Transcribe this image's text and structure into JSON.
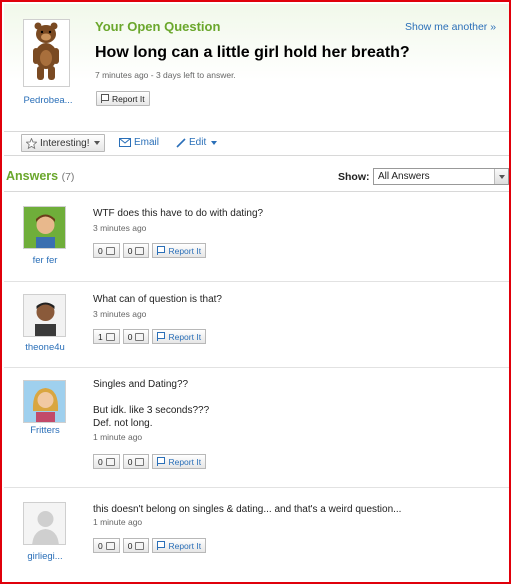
{
  "question": {
    "header_label": "Your Open Question",
    "show_another": "Show me another »",
    "title": "How long can a little girl hold her breath?",
    "meta": "7 minutes ago - 3 days left to answer.",
    "asker": "Pedrobea...",
    "report_label": "Report It"
  },
  "actions": {
    "interesting": "Interesting!",
    "email": "Email",
    "edit": "Edit"
  },
  "answers_header": {
    "title": "Answers",
    "count": "(7)",
    "show_label": "Show:",
    "show_value": "All Answers"
  },
  "answers": [
    {
      "user": "fer fer",
      "lines": [
        "WTF does this have to do with dating?"
      ],
      "time": "3 minutes ago",
      "up": "0",
      "down": "0",
      "report": "Report It"
    },
    {
      "user": "theone4u",
      "lines": [
        "What can of question is that?"
      ],
      "time": "3 minutes ago",
      "up": "1",
      "down": "0",
      "report": "Report It"
    },
    {
      "user": "Fritters",
      "lines": [
        "Singles and Dating??",
        "",
        "But idk. like 3 seconds???",
        "Def. not long."
      ],
      "time": "1 minute ago",
      "up": "0",
      "down": "0",
      "report": "Report It"
    },
    {
      "user": "girliegi...",
      "lines": [
        "this doesn't belong on singles & dating... and that's a weird question..."
      ],
      "time": "1 minute ago",
      "up": "0",
      "down": "0",
      "report": "Report It"
    }
  ],
  "colors": {
    "accent_green": "#6aa72c",
    "link_blue": "#2a6fb8",
    "frame_red": "#e0000b"
  }
}
